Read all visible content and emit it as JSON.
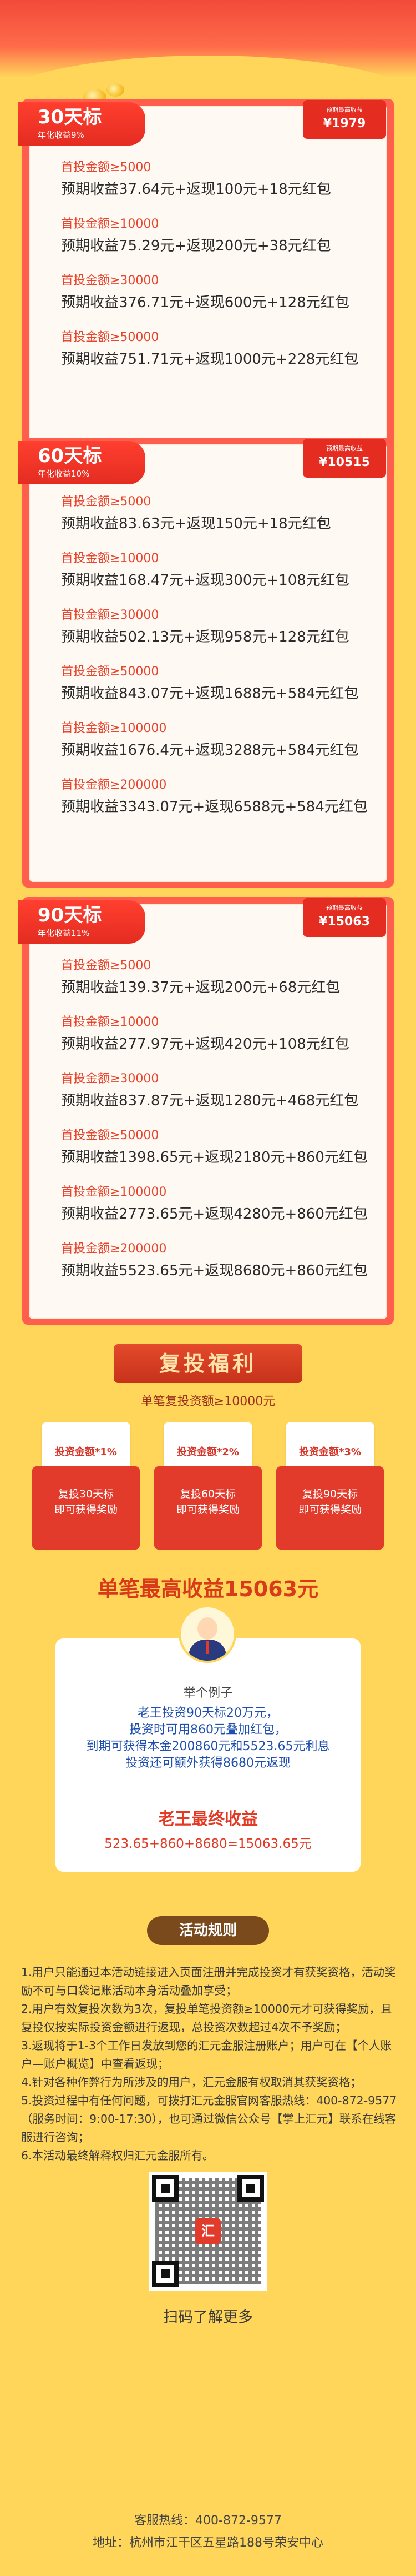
{
  "tiers": [
    {
      "days": "30天标",
      "rate": "年化收益9%",
      "peak_label": "预期最高收益",
      "peak_value": "¥1979",
      "rows": [
        {
          "cond": "首投金额≥5000",
          "earn": "预期收益37.64元+返现100元+18元红包"
        },
        {
          "cond": "首投金额≥10000",
          "earn": "预期收益75.29元+返现200元+38元红包"
        },
        {
          "cond": "首投金额≥30000",
          "earn": "预期收益376.71元+返现600元+128元红包"
        },
        {
          "cond": "首投金额≥50000",
          "earn": "预期收益751.71元+返现1000元+228元红包"
        }
      ]
    },
    {
      "days": "60天标",
      "rate": "年化收益10%",
      "peak_label": "预期最高收益",
      "peak_value": "¥10515",
      "rows": [
        {
          "cond": "首投金额≥5000",
          "earn": "预期收益83.63元+返现150元+18元红包"
        },
        {
          "cond": "首投金额≥10000",
          "earn": "预期收益168.47元+返现300元+108元红包"
        },
        {
          "cond": "首投金额≥30000",
          "earn": "预期收益502.13元+返现958元+128元红包"
        },
        {
          "cond": "首投金额≥50000",
          "earn": "预期收益843.07元+返现1688元+584元红包"
        },
        {
          "cond": "首投金额≥100000",
          "earn": "预期收益1676.4元+返现3288元+584元红包"
        },
        {
          "cond": "首投金额≥200000",
          "earn": "预期收益3343.07元+返现6588元+584元红包"
        }
      ]
    },
    {
      "days": "90天标",
      "rate": "年化收益11%",
      "peak_label": "预期最高收益",
      "peak_value": "¥15063",
      "rows": [
        {
          "cond": "首投金额≥5000",
          "earn": "预期收益139.37元+返现200元+68元红包"
        },
        {
          "cond": "首投金额≥10000",
          "earn": "预期收益277.97元+返现420元+108元红包"
        },
        {
          "cond": "首投金额≥30000",
          "earn": "预期收益837.87元+返现1280元+468元红包"
        },
        {
          "cond": "首投金额≥50000",
          "earn": "预期收益1398.65元+返现2180元+860元红包"
        },
        {
          "cond": "首投金额≥100000",
          "earn": "预期收益2773.65元+返现4280元+860元红包"
        },
        {
          "cond": "首投金额≥200000",
          "earn": "预期收益5523.65元+返现8680元+860元红包"
        }
      ]
    }
  ],
  "bonus": {
    "title": "复投福利",
    "subtitle": "单笔复投资额≥10000元",
    "cards": [
      {
        "ticket": "投资金额*1%",
        "line1": "复投30天标",
        "line2": "即可获得奖励"
      },
      {
        "ticket": "投资金额*2%",
        "line1": "复投60天标",
        "line2": "即可获得奖励"
      },
      {
        "ticket": "投资金额*3%",
        "line1": "复投90天标",
        "line2": "即可获得奖励"
      }
    ]
  },
  "max_title": "单笔最高收益15063元",
  "example": {
    "label": "举个例子",
    "lines": [
      "老王投资90天标20万元，",
      "投资时可用860元叠加红包，",
      "到期可获得本金200860元和5523.65元利息",
      "投资还可额外获得8680元返现"
    ],
    "final_title": "老王最终收益",
    "final_eq": "523.65+860+8680=15063.65元"
  },
  "rules": {
    "title": "活动规则",
    "items": [
      "1.用户只能通过本活动链接进入页面注册并完成投资才有获奖资格，活动奖励不可与口袋记账活动本身活动叠加享受；",
      "2.用户有效复投次数为3次，复投单笔投资额≥10000元才可获得奖励，且复投仅按实际投资金额进行返现，总投资次数超过4次不予奖励；",
      "3.返现将于1-3个工作日发放到您的汇元金服注册账户；用户可在【个人账户—账户概览】中查看返现；",
      "4.针对各种作弊行为所涉及的用户，汇元金服有权取消其获奖资格；",
      "5.投资过程中有任何问题，可拨打汇元金服官网客服热线：400-872-9577（服务时间：9:00-17:30），也可通过微信公众号【掌上汇元】联系在线客服进行咨询；",
      "6.本活动最终解释权归汇元金服所有。"
    ]
  },
  "qr_logo": "汇",
  "scan_text": "扫码了解更多",
  "footer": {
    "hotline": "客服热线：400-872-9577",
    "address": "地址：杭州市江干区五星路188号荣安中心"
  }
}
